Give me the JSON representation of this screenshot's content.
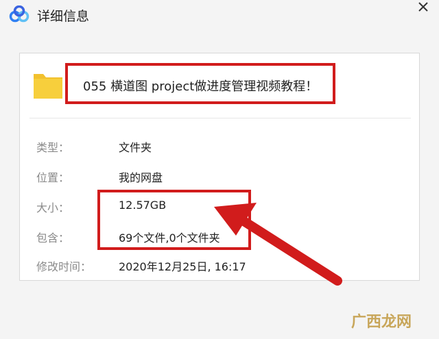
{
  "window": {
    "title": "详细信息",
    "close_icon": "close-icon",
    "logo_icon": "cloud-app-logo-icon"
  },
  "file": {
    "icon": "folder-icon",
    "name": "055 横道图 project做进度管理视频教程！"
  },
  "details": [
    {
      "label": "类型：",
      "value": "文件夹"
    },
    {
      "label": "位置：",
      "value": "我的网盘"
    },
    {
      "label": "大小：",
      "value": "12.57GB"
    },
    {
      "label": "包含：",
      "value": "69个文件,0个文件夹"
    },
    {
      "label": "修改时间：",
      "value": "2020年12月25日, 16:17"
    }
  ],
  "annotation": {
    "highlight_color": "#d11c1c"
  },
  "watermark": "广西龙网",
  "colors": {
    "folder": "#f7cf3c",
    "label_gray": "#8a8a8a",
    "logo_blue": "#2f7ff2"
  }
}
